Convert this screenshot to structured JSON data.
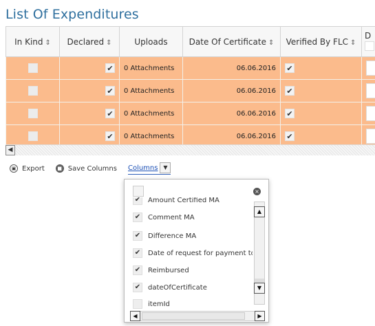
{
  "page": {
    "title": "List Of Expenditures"
  },
  "table": {
    "headers": [
      {
        "label": "In Kind",
        "sort": "⇕"
      },
      {
        "label": "Declared",
        "sort": "⇕"
      },
      {
        "label": "Uploads",
        "sort": ""
      },
      {
        "label": "Date Of Certificate",
        "sort": "⇕"
      },
      {
        "label": "Verified By FLC",
        "sort": "⇕"
      },
      {
        "label": "D",
        "sort": ""
      }
    ],
    "rows": [
      {
        "in_kind": false,
        "declared": true,
        "uploads": "0 Attachments",
        "date_of_certificate": "06.06.2016",
        "verified_by_flc": true
      },
      {
        "in_kind": false,
        "declared": true,
        "uploads": "0 Attachments",
        "date_of_certificate": "06.06.2016",
        "verified_by_flc": true
      },
      {
        "in_kind": false,
        "declared": true,
        "uploads": "0 Attachments",
        "date_of_certificate": "06.06.2016",
        "verified_by_flc": true
      },
      {
        "in_kind": false,
        "declared": true,
        "uploads": "0 Attachments",
        "date_of_certificate": "06.06.2016",
        "verified_by_flc": true
      }
    ],
    "row_color": "#fbbb8c",
    "check_mark": "✔"
  },
  "toolbar": {
    "export_label": "Export",
    "save_columns_label": "Save Columns",
    "columns_label": "Columns",
    "dropdown_arrow": "▼"
  },
  "columns_panel": {
    "close_symbol": "×",
    "items": [
      {
        "label": "Amount Certified MA",
        "checked": true
      },
      {
        "label": "Comment MA",
        "checked": true
      },
      {
        "label": "Difference MA",
        "checked": true
      },
      {
        "label": "Date of request for payment to B",
        "checked": true
      },
      {
        "label": "Reimbursed",
        "checked": true
      },
      {
        "label": "dateOfCertificate",
        "checked": true
      },
      {
        "label": "itemId",
        "checked": false
      }
    ]
  },
  "icons": {
    "export": "export-icon",
    "save": "save-icon",
    "sort": "sort-icon"
  }
}
